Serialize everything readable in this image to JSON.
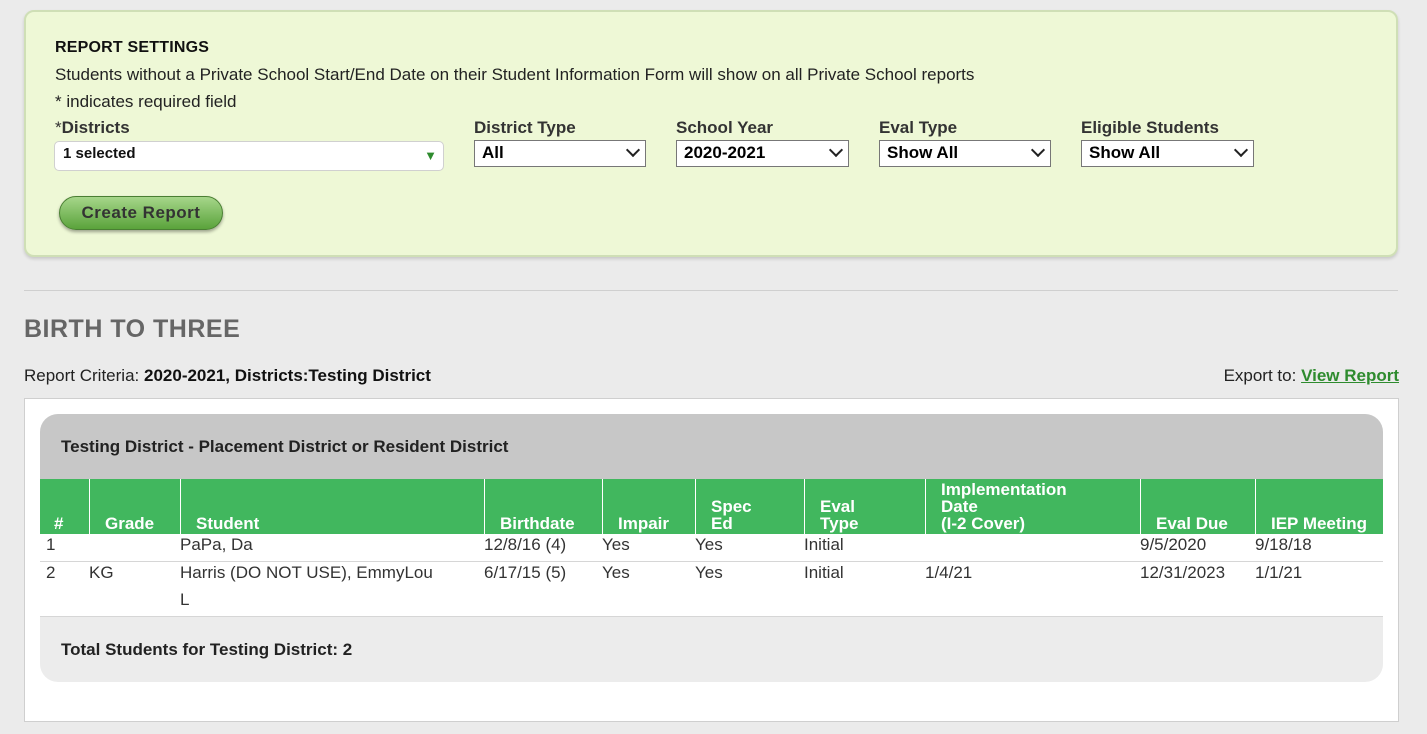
{
  "settings": {
    "title": "REPORT SETTINGS",
    "note": "Students without a Private School Start/End Date on their Student Information Form will show on all Private School reports",
    "required_note": "* indicates required field",
    "districts": {
      "star": "*",
      "label": "Districts",
      "value": "1 selected"
    },
    "district_type": {
      "label": "District Type",
      "value": "All"
    },
    "school_year": {
      "label": "School Year",
      "value": "2020-2021"
    },
    "eval_type": {
      "label": "Eval Type",
      "value": "Show All"
    },
    "eligible_students": {
      "label": "Eligible Students",
      "value": "Show All"
    },
    "create_button": "Create Report",
    "accent_color": "#41b75e"
  },
  "report": {
    "title": "BIRTH TO THREE",
    "criteria_label": "Report Criteria:",
    "criteria_value": "2020-2021, Districts:Testing District",
    "export_label": "Export to:",
    "export_link": "View Report",
    "group_title": "Testing District - Placement District or Resident District",
    "columns": [
      "#",
      "Grade",
      "Student",
      "Birthdate",
      "Impair",
      "Spec\nEd",
      "Eval\nType",
      "Implementation\nDate\n(I-2 Cover)",
      "Eval Due",
      "IEP Meeting"
    ],
    "rows": [
      [
        "1",
        "",
        "PaPa, Da",
        "12/8/16 (4)",
        "Yes",
        "Yes",
        "Initial",
        "",
        "9/5/2020",
        "9/18/18"
      ],
      [
        "2",
        "KG",
        "Harris (DO NOT USE), EmmyLou\nL",
        "6/17/15 (5)",
        "Yes",
        "Yes",
        "Initial",
        "1/4/21",
        "12/31/2023",
        "1/1/21"
      ]
    ],
    "total": "Total Students for Testing District: 2"
  }
}
